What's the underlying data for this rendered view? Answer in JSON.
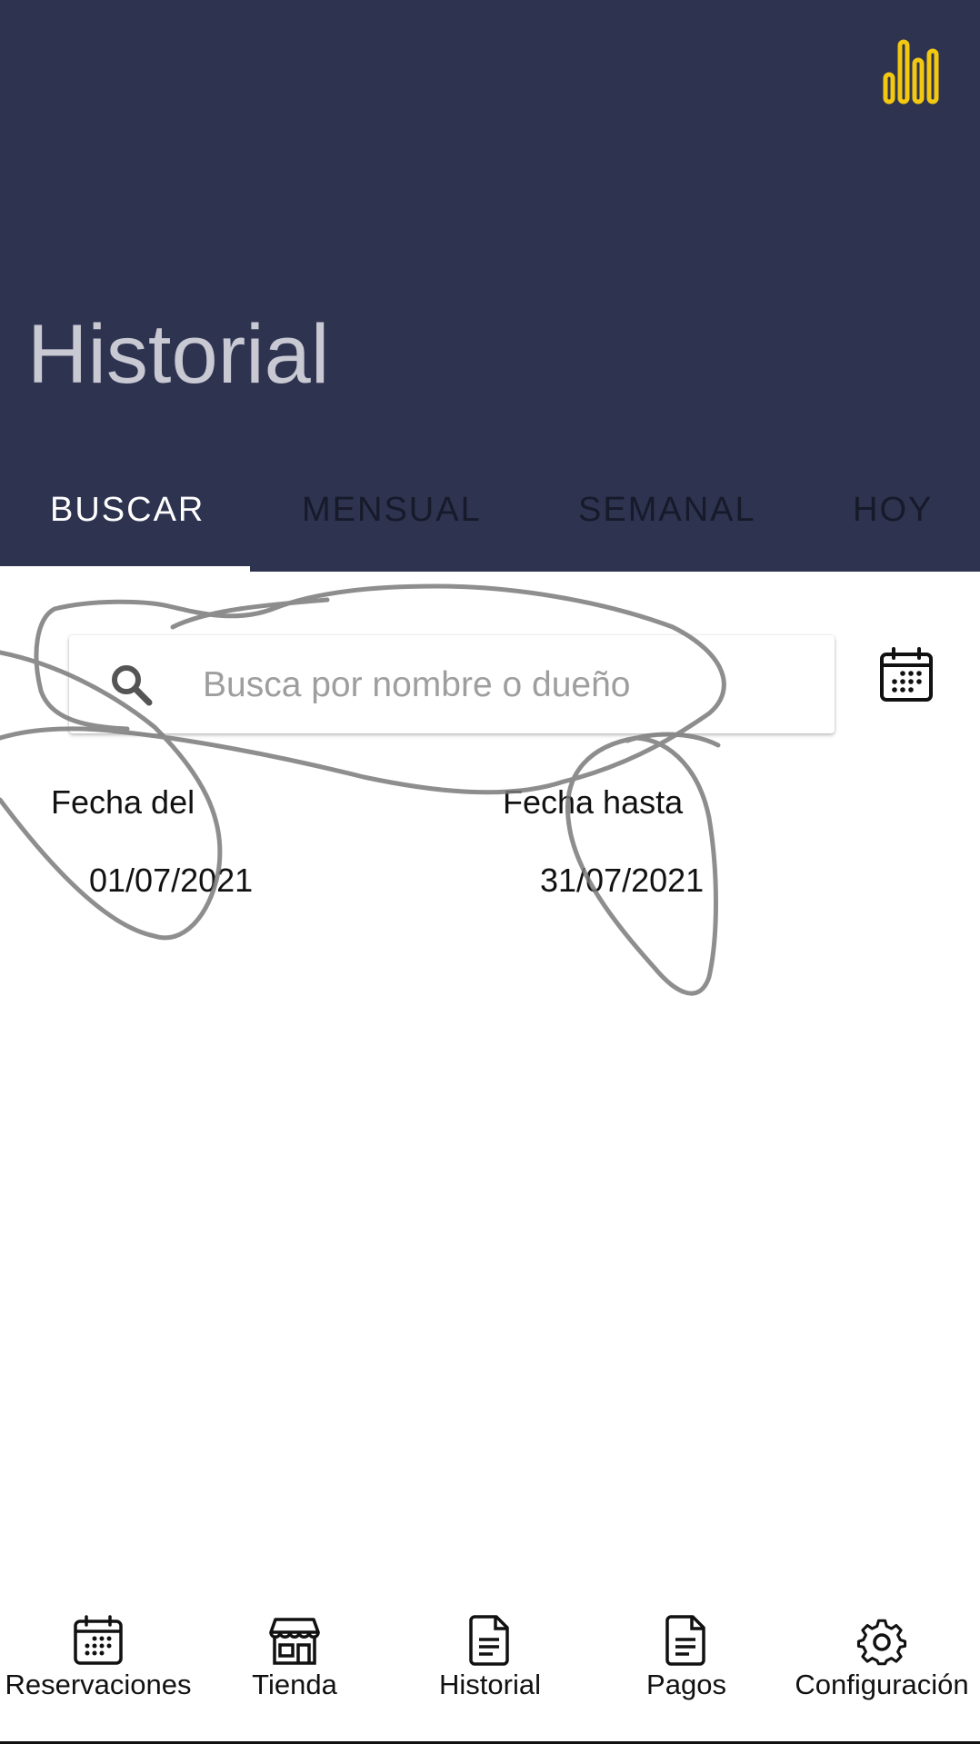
{
  "header": {
    "title": "Historial",
    "icon": "bar-chart-icon",
    "background": "#2e3350",
    "icon_color": "#f2c811"
  },
  "tabs": [
    {
      "label": "BUSCAR",
      "active": true
    },
    {
      "label": "MENSUAL",
      "active": false
    },
    {
      "label": "SEMANAL",
      "active": false
    },
    {
      "label": "HOY",
      "active": false
    }
  ],
  "search": {
    "placeholder": "Busca por nombre o dueño",
    "value": ""
  },
  "date_range": {
    "from_label": "Fecha del",
    "from_value": "01/07/2021",
    "to_label": "Fecha hasta",
    "to_value": "31/07/2021"
  },
  "bottom_nav": [
    {
      "label": "Reservaciones",
      "icon": "calendar-icon"
    },
    {
      "label": "Tienda",
      "icon": "store-icon"
    },
    {
      "label": "Historial",
      "icon": "document-icon"
    },
    {
      "label": "Pagos",
      "icon": "document-icon"
    },
    {
      "label": "Configuración",
      "icon": "gear-icon"
    }
  ]
}
